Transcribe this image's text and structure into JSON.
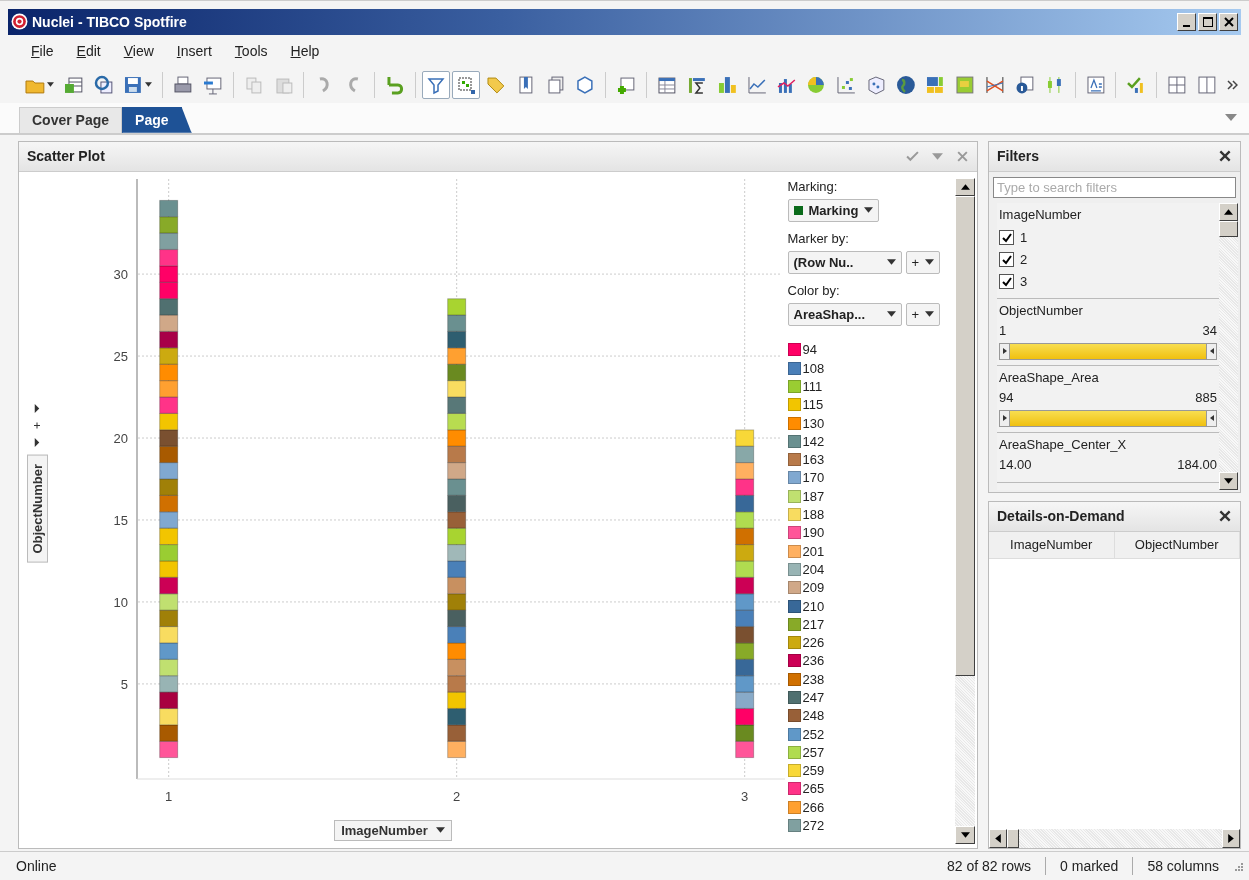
{
  "window": {
    "title": "Nuclei - TIBCO Spotfire"
  },
  "menu": [
    "File",
    "Edit",
    "View",
    "Insert",
    "Tools",
    "Help"
  ],
  "tabs": [
    {
      "label": "Cover Page",
      "selected": false
    },
    {
      "label": "Page",
      "selected": true
    }
  ],
  "scatter_plot": {
    "title": "Scatter Plot",
    "chart_data": {
      "type": "scatter",
      "xlabel": "ImageNumber",
      "ylabel": "ObjectNumber",
      "grid": true,
      "xlim": [
        0.89,
        3.14
      ],
      "xticks": [
        1,
        2,
        3
      ],
      "ylim": [
        -0.8,
        35.8
      ],
      "yticks": [
        5,
        10,
        15,
        20,
        25,
        30
      ],
      "series": [
        {
          "x": [
            1,
            1,
            1,
            1,
            1,
            1,
            1,
            1,
            1,
            1,
            1,
            1,
            1,
            1,
            1,
            1,
            1,
            1,
            1,
            1,
            1,
            1,
            1,
            1,
            1,
            1,
            1,
            1,
            1,
            1,
            1,
            1,
            1,
            1
          ],
          "values": [
            1,
            2,
            3,
            4,
            5,
            6,
            7,
            8,
            9,
            10,
            11,
            12,
            13,
            14,
            15,
            16,
            17,
            18,
            19,
            20,
            21,
            22,
            23,
            24,
            25,
            26,
            27,
            28,
            29,
            30,
            31,
            32,
            33,
            34
          ],
          "colors": [
            "#ff5599",
            "#a85a00",
            "#f8dc60",
            "#a80040",
            "#98b4b4",
            "#c0e070",
            "#6098c8",
            "#f8dc60",
            "#a08008",
            "#c0e070",
            "#cc0055",
            "#f2c500",
            "#9acd32",
            "#f2c500",
            "#80a8d0",
            "#d07000",
            "#a08008",
            "#80a8d0",
            "#a85a00",
            "#7a5030",
            "#f2c500",
            "#ff3388",
            "#ffa030",
            "#ff8c00",
            "#ccaa10",
            "#a80048",
            "#d0a888",
            "#507070",
            "#ff0066",
            "#ff0066",
            "#ff3388",
            "#80a0a0",
            "#88aa28",
            "#6a9090"
          ]
        },
        {
          "x": [
            2,
            2,
            2,
            2,
            2,
            2,
            2,
            2,
            2,
            2,
            2,
            2,
            2,
            2,
            2,
            2,
            2,
            2,
            2,
            2,
            2,
            2,
            2,
            2,
            2,
            2,
            2,
            2
          ],
          "values": [
            1,
            2,
            3,
            4,
            5,
            6,
            7,
            8,
            9,
            10,
            11,
            12,
            13,
            14,
            15,
            16,
            17,
            18,
            19,
            20,
            21,
            22,
            23,
            24,
            25,
            26,
            27,
            28
          ],
          "colors": [
            "#ffb060",
            "#986038",
            "#2e5e70",
            "#f2c500",
            "#b87a4a",
            "#c89060",
            "#ff8c00",
            "#4a80b8",
            "#4a6060",
            "#a08008",
            "#c89060",
            "#4a80b8",
            "#a0b8b8",
            "#a8d430",
            "#986038",
            "#4a6060",
            "#6a9090",
            "#d0a888",
            "#b87a4a",
            "#ff8c00",
            "#b8dc50",
            "#587878",
            "#f8dc60",
            "#6a8a20",
            "#ffa030",
            "#2e5e70",
            "#6a9090",
            "#a8d430"
          ]
        },
        {
          "x": [
            3,
            3,
            3,
            3,
            3,
            3,
            3,
            3,
            3,
            3,
            3,
            3,
            3,
            3,
            3,
            3,
            3,
            3,
            3,
            3
          ],
          "values": [
            1,
            2,
            3,
            4,
            5,
            6,
            7,
            8,
            9,
            10,
            11,
            12,
            13,
            14,
            15,
            16,
            17,
            18,
            19,
            20
          ],
          "colors": [
            "#ff5599",
            "#6a8a20",
            "#ff0066",
            "#88aac8",
            "#6098c8",
            "#386898",
            "#88aa28",
            "#7a5030",
            "#4a80b8",
            "#6098c8",
            "#cc0055",
            "#b0dc50",
            "#ccaa10",
            "#d07000",
            "#b0dc50",
            "#386898",
            "#ff3388",
            "#ffb060",
            "#88a8a8",
            "#f8d838"
          ]
        }
      ]
    },
    "legend_panel": {
      "marking_label": "Marking:",
      "marking_value": "Marking",
      "marker_by_label": "Marker by:",
      "marker_by_value": "(Row Nu..",
      "color_by_label": "Color by:",
      "color_by_value": "AreaShap...",
      "add_buttons": [
        "+",
        "+"
      ]
    },
    "legend": [
      {
        "label": "94",
        "color": "#ff0066"
      },
      {
        "label": "108",
        "color": "#4a7fb8"
      },
      {
        "label": "111",
        "color": "#9acd32"
      },
      {
        "label": "115",
        "color": "#f2c500"
      },
      {
        "label": "130",
        "color": "#ff8c00"
      },
      {
        "label": "142",
        "color": "#6a9090"
      },
      {
        "label": "163",
        "color": "#b87a4a"
      },
      {
        "label": "170",
        "color": "#80a8d0"
      },
      {
        "label": "187",
        "color": "#c0e070"
      },
      {
        "label": "188",
        "color": "#f8dc60"
      },
      {
        "label": "190",
        "color": "#ff5599"
      },
      {
        "label": "201",
        "color": "#ffb060"
      },
      {
        "label": "204",
        "color": "#98b4b4"
      },
      {
        "label": "209",
        "color": "#d0a888"
      },
      {
        "label": "210",
        "color": "#386898"
      },
      {
        "label": "217",
        "color": "#88aa28"
      },
      {
        "label": "226",
        "color": "#ccaa10"
      },
      {
        "label": "236",
        "color": "#cc0055"
      },
      {
        "label": "238",
        "color": "#d07000"
      },
      {
        "label": "247",
        "color": "#507070"
      },
      {
        "label": "248",
        "color": "#986038"
      },
      {
        "label": "252",
        "color": "#6098c8"
      },
      {
        "label": "257",
        "color": "#b0dc50"
      },
      {
        "label": "259",
        "color": "#f8d838"
      },
      {
        "label": "265",
        "color": "#ff3388"
      },
      {
        "label": "266",
        "color": "#ffa030"
      },
      {
        "label": "272",
        "color": "#80a0a0"
      }
    ]
  },
  "filters": {
    "title": "Filters",
    "search": {
      "placeholder": "Type to search filters"
    },
    "groups": [
      {
        "kind": "checkboxes",
        "name": "ImageNumber",
        "items": [
          {
            "label": "1",
            "checked": true
          },
          {
            "label": "2",
            "checked": true
          },
          {
            "label": "3",
            "checked": true
          }
        ]
      },
      {
        "kind": "range",
        "name": "ObjectNumber",
        "min": "1",
        "max": "34",
        "level": 1
      },
      {
        "kind": "range",
        "name": "AreaShape_Area",
        "min": "94",
        "max": "885",
        "level": 1
      },
      {
        "kind": "range_values",
        "name": "AreaShape_Center_X",
        "min": "14.00",
        "max": "184.00"
      }
    ]
  },
  "details": {
    "title": "Details-on-Demand",
    "columns": [
      "ImageNumber",
      "ObjectNumber"
    ]
  },
  "status_bar": {
    "state": "Online",
    "rows": "82 of 82 rows",
    "marked": "0 marked",
    "columns": "58 columns"
  }
}
